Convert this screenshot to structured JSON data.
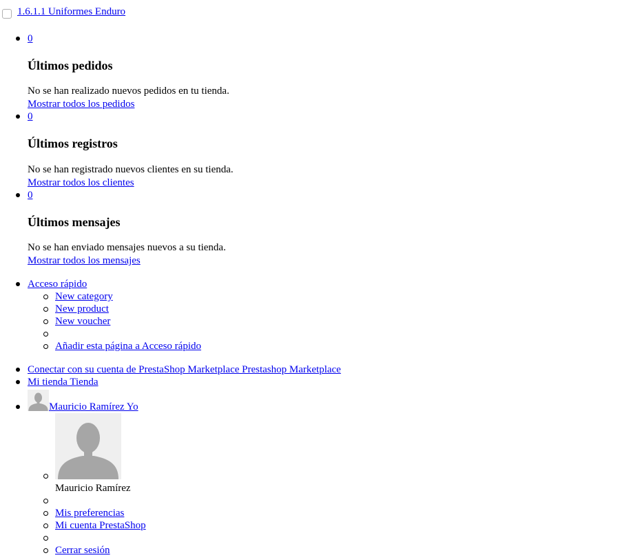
{
  "header": {
    "version_link": "1.6.1.1 Uniformes Enduro"
  },
  "notifications": [
    {
      "count": "0",
      "title": "Últimos pedidos",
      "empty_text": "No se han realizado nuevos pedidos en tu tienda.",
      "link": "Mostrar todos los pedidos"
    },
    {
      "count": "0",
      "title": "Últimos registros",
      "empty_text": "No se han registrado nuevos clientes en su tienda.",
      "link": "Mostrar todos los clientes"
    },
    {
      "count": "0",
      "title": "Últimos mensajes",
      "empty_text": "No se han enviado mensajes nuevos a su tienda.",
      "link": "Mostrar todos los mensajes"
    }
  ],
  "quick_access": {
    "label": "Acceso rápido",
    "items": [
      "New category",
      "New product",
      "New voucher",
      "",
      "Añadir esta página a Acceso rápido"
    ]
  },
  "marketplace_link": "Conectar con su cuenta de PrestaShop Marketplace Prestashop Marketplace",
  "shop_link": "Mi tienda Tienda",
  "employee": {
    "link": " Mauricio Ramírez Yo",
    "name": "Mauricio Ramírez",
    "preferences": " Mis preferencias",
    "prestashop_account": " Mi cuenta PrestaShop",
    "logout": " Cerrar sesión"
  },
  "icons": {
    "avatar": "user-silhouette-icon",
    "checkbox": "checkbox-icon"
  }
}
